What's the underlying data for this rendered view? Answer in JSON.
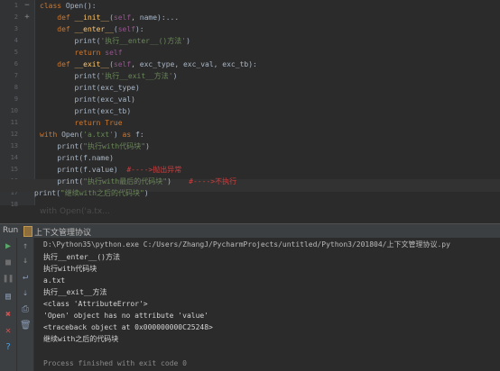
{
  "editor": {
    "lines": [
      {
        "num": "1",
        "fold": "−"
      },
      {
        "num": "2",
        "fold": "+"
      },
      {
        "num": "3",
        "fold": ""
      },
      {
        "num": "4",
        "fold": ""
      },
      {
        "num": "5",
        "fold": ""
      },
      {
        "num": "6",
        "fold": ""
      },
      {
        "num": "7",
        "fold": ""
      },
      {
        "num": "8",
        "fold": ""
      },
      {
        "num": "9",
        "fold": ""
      },
      {
        "num": "10",
        "fold": ""
      },
      {
        "num": "11",
        "fold": ""
      },
      {
        "num": "12",
        "fold": ""
      },
      {
        "num": "13",
        "fold": ""
      },
      {
        "num": "14",
        "fold": ""
      },
      {
        "num": "15",
        "fold": ""
      },
      {
        "num": "16",
        "fold": ""
      },
      {
        "num": "17",
        "fold": ""
      },
      {
        "num": "18",
        "fold": ""
      }
    ],
    "code": {
      "l1_a": "class ",
      "l1_b": "Open",
      "l1_c": "():",
      "l2_a": "    def ",
      "l2_b": "__init__",
      "l2_c": "(",
      "l2_d": "self",
      "l2_e": ", name):...",
      "l3_a": "    def ",
      "l3_b": "__enter__",
      "l3_c": "(",
      "l3_d": "self",
      "l3_e": "):",
      "l4_a": "        print(",
      "l4_b": "'执行__enter__()方法'",
      "l4_c": ")",
      "l5_a": "        return ",
      "l5_b": "self",
      "l6_a": "    def ",
      "l6_b": "__exit__",
      "l6_c": "(",
      "l6_d": "self",
      "l6_e": ", exc_type, exc_val, exc_tb):",
      "l7_a": "        print(",
      "l7_b": "'执行__exit__方法'",
      "l7_c": ")",
      "l8": "        print(exc_type)",
      "l9": "        print(exc_val)",
      "l10": "        print(exc_tb)",
      "l11_a": "        return ",
      "l11_b": "True",
      "l12_a": "with ",
      "l12_b": "Open(",
      "l12_c": "'a.txt'",
      "l12_d": ") ",
      "l12_e": "as ",
      "l12_f": "f:",
      "l13_a": "    print(",
      "l13_b": "\"执行with代码块\"",
      "l13_c": ")",
      "l14": "    print(f.name)",
      "l15_a": "    print(f.value)  ",
      "l15_b": "#---->抛出异常",
      "l16_a": "    print(",
      "l16_b": "\"执行with最后的代码块\"",
      "l16_c": ")    ",
      "l16_d": "#---->不执行",
      "l17_a": "print(",
      "l17_b": "\"继续with之后的代码块\"",
      "l17_c": ")"
    },
    "hint": "with Open('a.tx..."
  },
  "run": {
    "label": "Run",
    "tab_name": "上下文管理协议"
  },
  "console": {
    "command": "D:\\Python35\\python.exe C:/Users/ZhangJ/PycharmProjects/untitled/Python3/201804/上下文管理协议.py",
    "out1": "执行__enter__()方法",
    "out2": "执行with代码块",
    "out3": "a.txt",
    "out4": "执行__exit__方法",
    "out5": "<class 'AttributeError'>",
    "out6": "'Open' object has no attribute 'value'",
    "out7": "<traceback object at 0x000000000C25248>",
    "out8": "继续with之后的代码块",
    "finish": "Process finished with exit code 0"
  },
  "icons": {
    "run": "play-icon",
    "stop": "stop-icon",
    "pause": "pause-icon",
    "up": "arrow-up-icon",
    "down": "arrow-down-icon",
    "wrap": "soft-wrap-icon",
    "scroll": "scroll-to-end-icon",
    "print": "print-icon",
    "trash": "trash-icon",
    "layout": "layout-icon",
    "pin": "pin-icon",
    "close": "close-icon",
    "help": "help-icon"
  },
  "colors": {
    "keyword": "#cc7832",
    "function": "#ffc66d",
    "string": "#6a8759",
    "self": "#94558d",
    "comment": "#cc3e3e",
    "run_green": "#59a869"
  }
}
